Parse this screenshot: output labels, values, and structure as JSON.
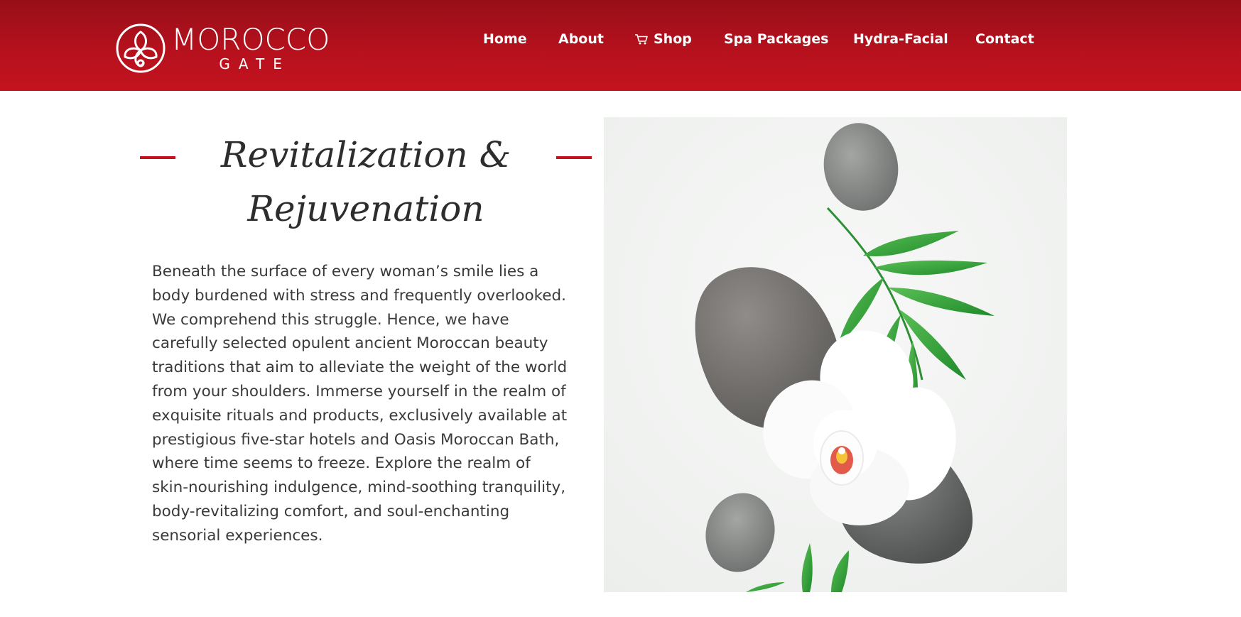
{
  "brand": {
    "name": "MOROCCO",
    "sub": "GATE"
  },
  "nav": {
    "items": [
      {
        "label": "Home",
        "name": "nav-home"
      },
      {
        "label": "About",
        "name": "nav-about"
      },
      {
        "label": "Shop",
        "name": "nav-shop",
        "icon": "cart-icon"
      },
      {
        "label": "Spa Packages",
        "name": "nav-spa-packages"
      },
      {
        "label": "Hydra-Facial",
        "name": "nav-hydra-facial"
      },
      {
        "label": "Contact",
        "name": "nav-contact"
      }
    ]
  },
  "section": {
    "title_line1": "Revitalization &",
    "title_line2": "Rejuvenation",
    "body": "Beneath the surface of every woman’s smile lies a body burdened with stress and frequently overlooked. We comprehend this struggle. Hence, we have carefully selected opulent ancient Moroccan beauty traditions that aim to alleviate the weight of the world from your shoulders. Immerse yourself in the realm of exquisite rituals and products, exclusively available at prestigious five-star hotels and Oasis Moroccan Bath, where time seems to freeze. Explore the realm of skin-nourishing indulgence, mind-soothing tranquility, body-revitalizing comfort, and soul-enchanting sensorial experiences."
  },
  "colors": {
    "header_top": "#970f18",
    "header_bottom": "#c4131f",
    "accent": "#c4131f",
    "title_text": "#2d2d2d",
    "body_text": "#3a3a3a"
  }
}
